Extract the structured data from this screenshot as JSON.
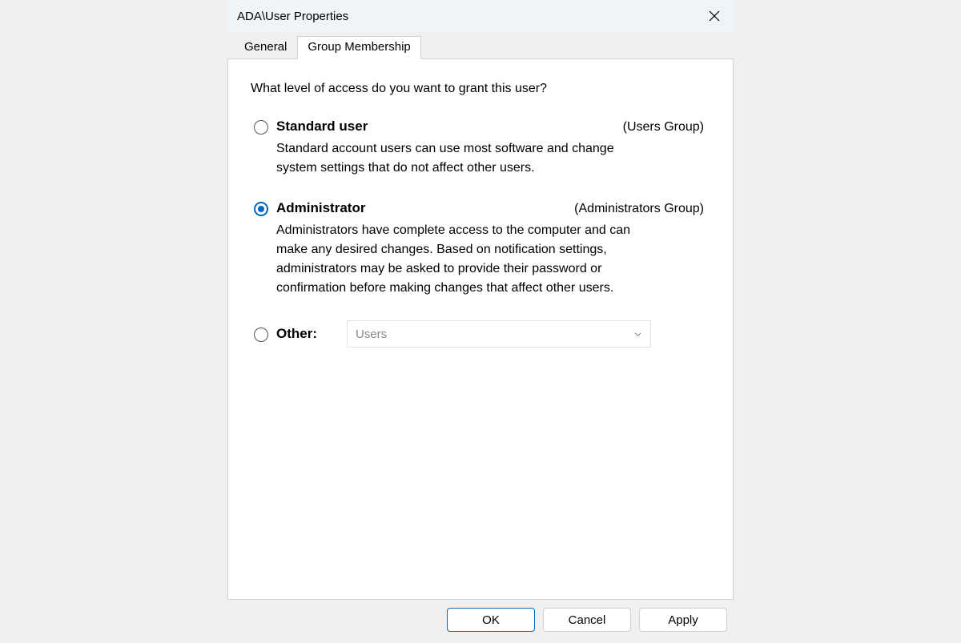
{
  "titlebar": {
    "title": "ADA\\User Properties"
  },
  "tabs": {
    "general": "General",
    "group_membership": "Group Membership"
  },
  "content": {
    "prompt": "What level of access do you want to grant this user?",
    "options": {
      "standard": {
        "title": "Standard user",
        "group": "(Users Group)",
        "desc": "Standard account users can use most software and change system settings that do not affect other users."
      },
      "admin": {
        "title": "Administrator",
        "group": "(Administrators Group)",
        "desc": "Administrators have complete access to the computer and can make any desired changes. Based on notification settings, administrators may be asked to provide their password or confirmation before making changes that affect other users."
      },
      "other": {
        "title": "Other:",
        "combo_value": "Users"
      }
    }
  },
  "buttons": {
    "ok": "OK",
    "cancel": "Cancel",
    "apply": "Apply"
  }
}
